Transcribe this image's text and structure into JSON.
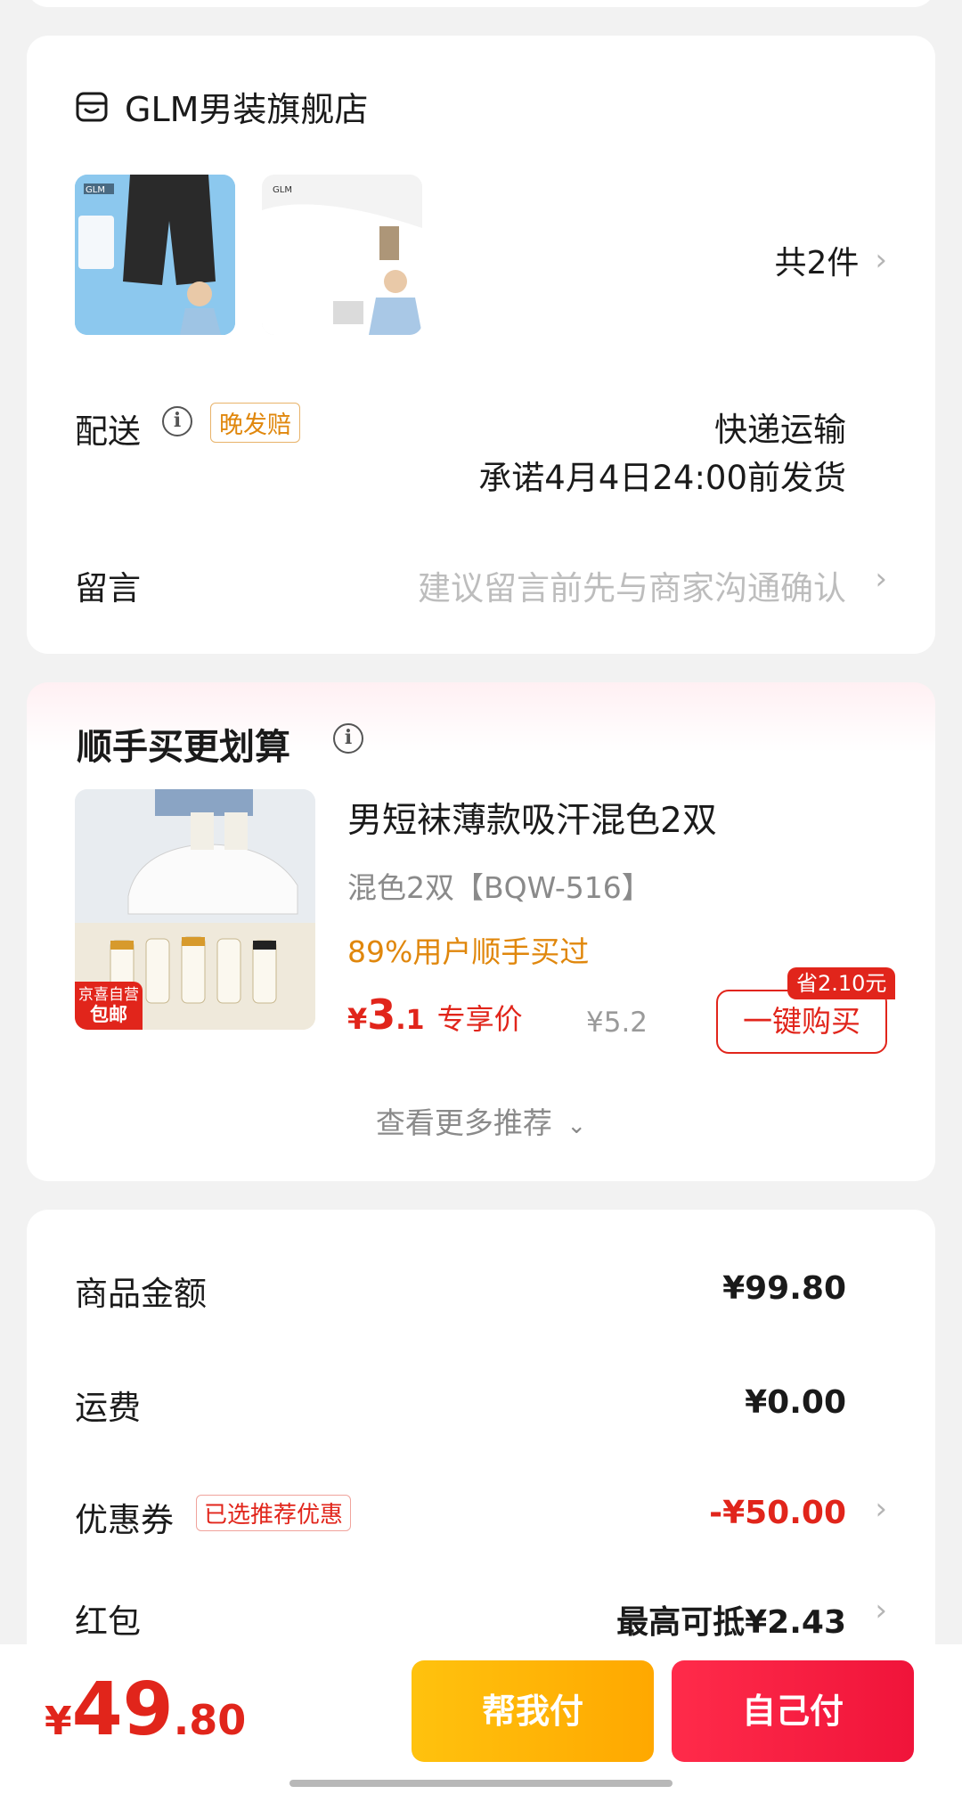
{
  "store": {
    "name": "GLM男装旗舰店",
    "item_count": "共2件",
    "thumbs": [
      "GLM",
      "GLM"
    ]
  },
  "shipping": {
    "label": "配送",
    "late_badge": "晚发赔",
    "method": "快递运输",
    "promise": "承诺4月4日24:00前发货"
  },
  "note": {
    "label": "留言",
    "placeholder": "建议留言前先与商家沟通确认"
  },
  "recommend": {
    "title": "顺手买更划算",
    "item": {
      "name": "男短袜薄款吸汗混色2双",
      "spec": "混色2双【BQW-516】",
      "popularity": "89%用户顺手买过",
      "price_currency": "¥",
      "price_int": "3",
      "price_dec": ".1",
      "price_tag": "专享价",
      "original_price": "¥5.2",
      "save_badge": "省2.10元",
      "buy_label": "一键购买",
      "jd_badge_line1": "京喜自营",
      "jd_badge_line2": "包邮"
    },
    "more_label": "查看更多推荐"
  },
  "price_details": {
    "goods_label": "商品金额",
    "goods_value": "¥99.80",
    "freight_label": "运费",
    "freight_value": "¥0.00",
    "coupon_label": "优惠券",
    "coupon_badge": "已选推荐优惠",
    "coupon_value": "-¥50.00",
    "redpacket_label": "红包",
    "redpacket_value": "最高可抵¥2.43"
  },
  "bottom": {
    "total_currency": "¥",
    "total_int": "49",
    "total_dec": ".80",
    "pay_friend_label": "帮我付",
    "pay_self_label": "自己付"
  },
  "colors": {
    "accent_red": "#e1251b",
    "accent_orange": "#e0870c",
    "pay_friend": "#ffb400",
    "pay_self": "#f5163c"
  }
}
